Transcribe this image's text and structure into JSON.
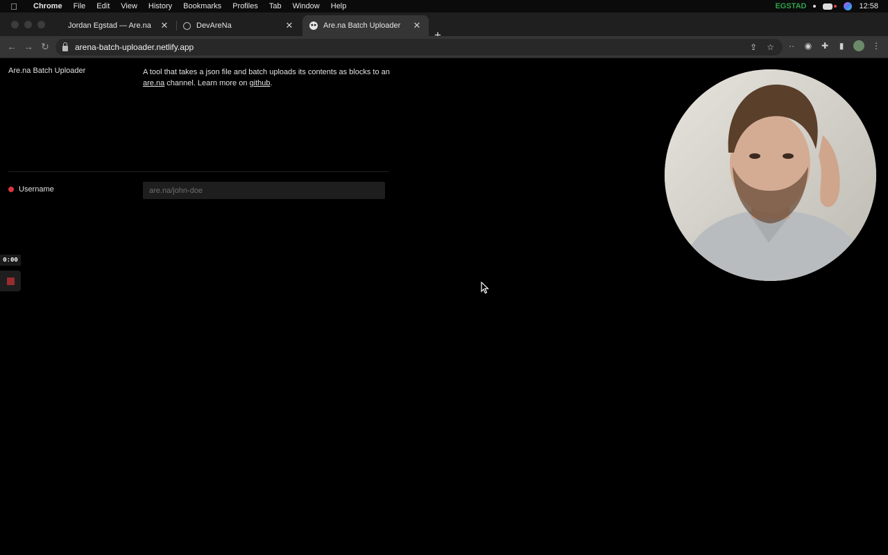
{
  "menubar": {
    "app": "Chrome",
    "items": [
      "File",
      "Edit",
      "View",
      "History",
      "Bookmarks",
      "Profiles",
      "Tab",
      "Window",
      "Help"
    ],
    "status_user": "EGSTAD",
    "clock": "12:58"
  },
  "tabs": [
    {
      "title": "Jordan Egstad — Are.na",
      "active": false
    },
    {
      "title": "DevAreNa",
      "active": false
    },
    {
      "title": "Are.na Batch Uploader",
      "active": true
    }
  ],
  "toolbar": {
    "url": "arena-batch-uploader.netlify.app"
  },
  "page": {
    "site_title": "Are.na Batch Uploader",
    "description_pre": "A tool that takes a json file and batch uploads its contents as blocks to an",
    "arena_link": "are.na",
    "description_mid": "channel. Learn more on",
    "github_link": "github",
    "description_end": ".",
    "username_label": "Username",
    "username_placeholder": "are.na/john-doe",
    "username_value": ""
  },
  "recorder": {
    "timer": "0:00"
  },
  "colors": {
    "required_dot": "#d9363e",
    "egstad": "#2fa14b",
    "background": "#000000"
  }
}
